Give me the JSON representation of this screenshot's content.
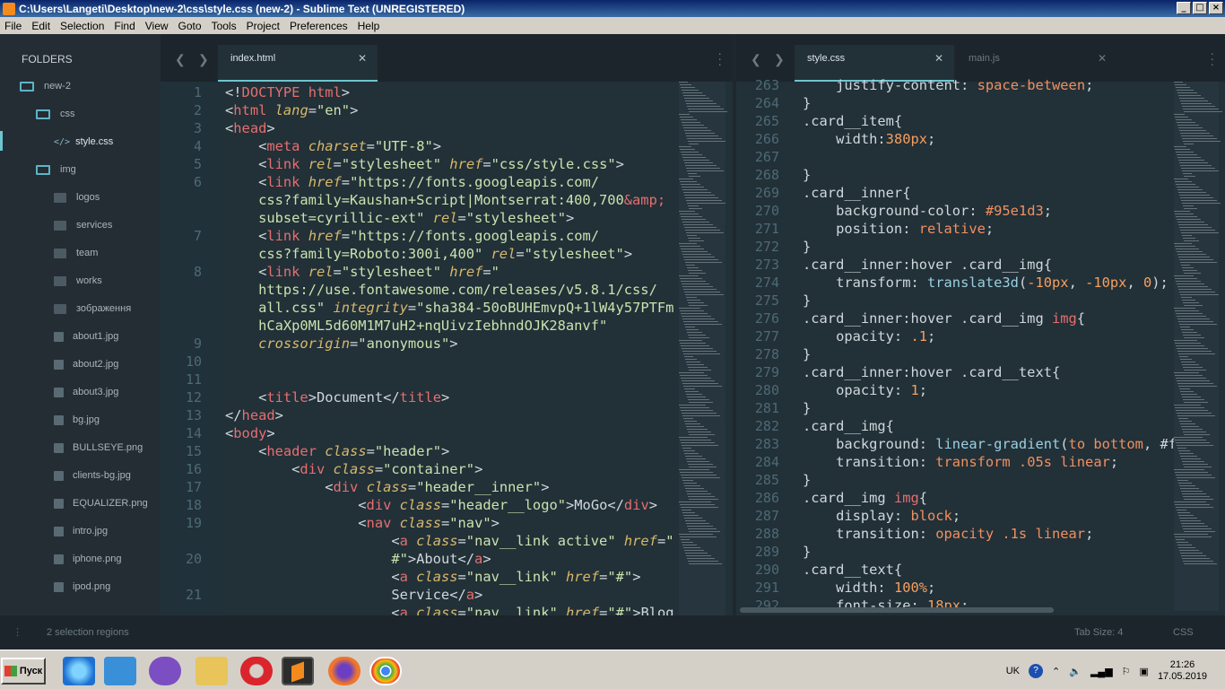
{
  "title": "C:\\Users\\Langeti\\Desktop\\new-2\\css\\style.css (new-2) - Sublime Text (UNREGISTERED)",
  "menu": [
    "File",
    "Edit",
    "Selection",
    "Find",
    "View",
    "Goto",
    "Tools",
    "Project",
    "Preferences",
    "Help"
  ],
  "sidebar": {
    "header": "FOLDERS",
    "items": [
      {
        "label": "new-2",
        "type": "folder-open"
      },
      {
        "label": "css",
        "type": "folder-open"
      },
      {
        "label": "style.css",
        "type": "code-file"
      },
      {
        "label": "img",
        "type": "folder-open"
      },
      {
        "label": "logos",
        "type": "folder"
      },
      {
        "label": "services",
        "type": "folder"
      },
      {
        "label": "team",
        "type": "folder"
      },
      {
        "label": "works",
        "type": "folder"
      },
      {
        "label": "зображення",
        "type": "folder"
      },
      {
        "label": "about1.jpg",
        "type": "image"
      },
      {
        "label": "about2.jpg",
        "type": "image"
      },
      {
        "label": "about3.jpg",
        "type": "image"
      },
      {
        "label": "bg.jpg",
        "type": "image"
      },
      {
        "label": "BULLSEYE.png",
        "type": "image"
      },
      {
        "label": "clients-bg.jpg",
        "type": "image"
      },
      {
        "label": "EQUALIZER.png",
        "type": "image"
      },
      {
        "label": "intro.jpg",
        "type": "image"
      },
      {
        "label": "iphone.png",
        "type": "image"
      },
      {
        "label": "ipod.png",
        "type": "image"
      }
    ]
  },
  "left_pane": {
    "tab": "index.html",
    "line_numbers": [
      "1",
      "2",
      "3",
      "4",
      "5",
      "6",
      "",
      "",
      "7",
      "",
      "8",
      "",
      "",
      "",
      "9",
      "10",
      "11",
      "12",
      "13",
      "14",
      "15",
      "16",
      "17",
      "18",
      "19",
      "",
      "20",
      "",
      "21"
    ]
  },
  "right_pane": {
    "tabs": [
      "style.css",
      "main.js"
    ],
    "line_numbers": [
      "263",
      "264",
      "265",
      "266",
      "267",
      "268",
      "269",
      "270",
      "271",
      "272",
      "273",
      "274",
      "275",
      "276",
      "277",
      "278",
      "279",
      "280",
      "281",
      "282",
      "283",
      "284",
      "285",
      "286",
      "287",
      "288",
      "289",
      "290",
      "291",
      "292"
    ]
  },
  "status": {
    "left": "2 selection regions",
    "tab_size": "Tab Size: 4",
    "syntax": "CSS"
  },
  "taskbar": {
    "start": "Пуск",
    "lang": "UK",
    "time": "21:26",
    "date": "17.05.2019"
  },
  "colors": {
    "accent": "#6ec4cf",
    "tag": "#e56f6f",
    "attr": "#d7b96a",
    "string": "#c9e3ad",
    "value": "#f09060"
  }
}
